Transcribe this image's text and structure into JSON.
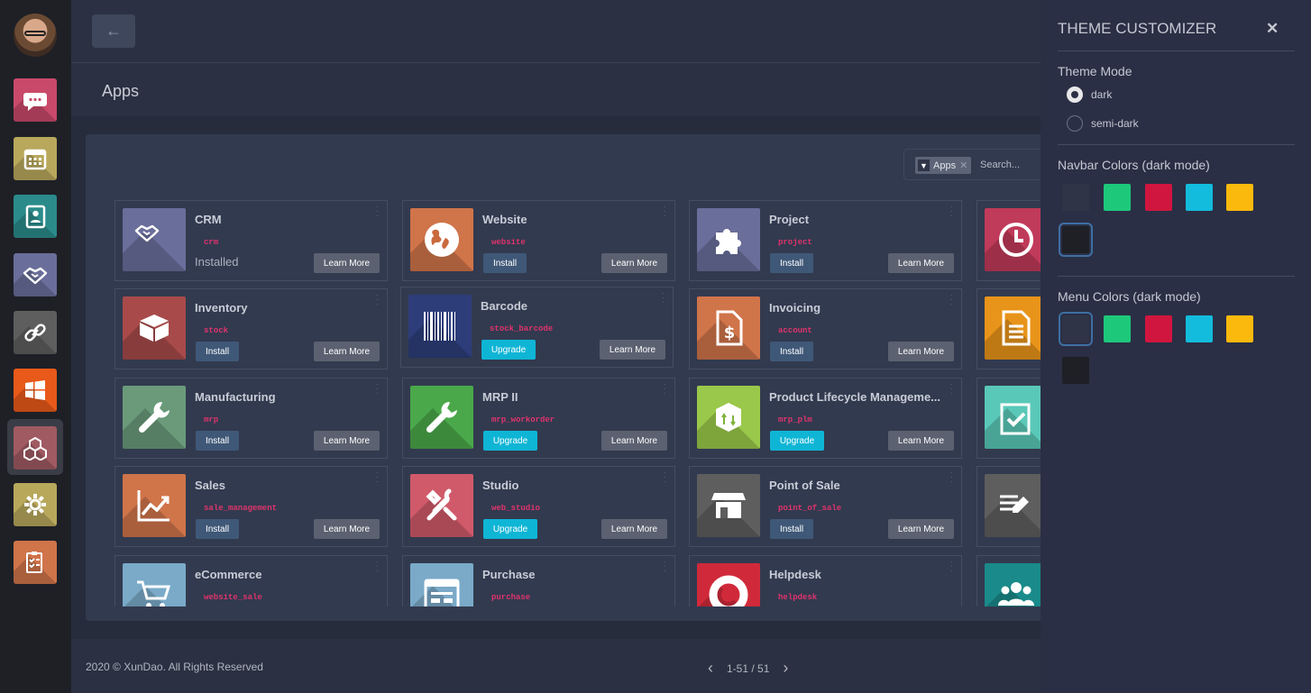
{
  "sidebar": {
    "items": [
      {
        "name": "discuss",
        "icon": "chat-icon",
        "color": "#c9496a"
      },
      {
        "name": "calendar",
        "icon": "calendar-icon",
        "color": "#b8a85c"
      },
      {
        "name": "contacts",
        "icon": "contacts-icon",
        "color": "#2b8b8b"
      },
      {
        "name": "crm",
        "icon": "handshake-icon",
        "color": "#6a6e9a"
      },
      {
        "name": "link",
        "icon": "link-icon",
        "color": "#5e5e5e"
      },
      {
        "name": "windows",
        "icon": "windows-icon",
        "color": "#e8591a"
      },
      {
        "name": "apps",
        "icon": "cubes-icon",
        "color": "#a05a62"
      },
      {
        "name": "settings",
        "icon": "gear-icon",
        "color": "#b8a85c"
      },
      {
        "name": "survey",
        "icon": "survey-icon",
        "color": "#d0744a"
      }
    ]
  },
  "header": {
    "back_icon": "arrow-left-icon",
    "title": "Apps"
  },
  "search": {
    "facet_label": "Apps",
    "placeholder": "Search..."
  },
  "apps": [
    {
      "name": "CRM",
      "tech": "crm",
      "status": "installed",
      "installed_label": "Installed",
      "learn_label": "Learn More",
      "color": "#6a6e9a",
      "icon": "handshake-icon"
    },
    {
      "name": "Website",
      "tech": "website",
      "status": "install",
      "action_label": "Install",
      "learn_label": "Learn More",
      "color": "#d0744a",
      "icon": "globe-icon"
    },
    {
      "name": "Project",
      "tech": "project",
      "status": "install",
      "action_label": "Install",
      "learn_label": "Learn More",
      "color": "#6a6e9a",
      "icon": "puzzle-icon"
    },
    {
      "name": "Inventory",
      "tech": "stock",
      "status": "install",
      "action_label": "Install",
      "learn_label": "Learn More",
      "color": "#a84a4a",
      "icon": "box-icon"
    },
    {
      "name": "Barcode",
      "tech": "stock_barcode",
      "status": "upgrade",
      "action_label": "Upgrade",
      "learn_label": "Learn More",
      "color": "#2d3d7a",
      "icon": "barcode-icon"
    },
    {
      "name": "Invoicing",
      "tech": "account",
      "status": "install",
      "action_label": "Install",
      "learn_label": "Learn More",
      "color": "#d0744a",
      "icon": "invoice-icon"
    },
    {
      "name": "Manufacturing",
      "tech": "mrp",
      "status": "install",
      "action_label": "Install",
      "learn_label": "Learn More",
      "color": "#6a9a7a",
      "icon": "wrench-icon"
    },
    {
      "name": "MRP II",
      "tech": "mrp_workorder",
      "status": "upgrade",
      "action_label": "Upgrade",
      "learn_label": "Learn More",
      "color": "#4aa84a",
      "icon": "wrench-icon"
    },
    {
      "name": "Product Lifecycle Manageme...",
      "tech": "mrp_plm",
      "status": "upgrade",
      "action_label": "Upgrade",
      "learn_label": "Learn More",
      "color": "#9ac84a",
      "icon": "cube-icon"
    },
    {
      "name": "Sales",
      "tech": "sale_management",
      "status": "install",
      "action_label": "Install",
      "learn_label": "Learn More",
      "color": "#d0744a",
      "icon": "chart-icon"
    },
    {
      "name": "Studio",
      "tech": "web_studio",
      "status": "upgrade",
      "action_label": "Upgrade",
      "learn_label": "Learn More",
      "color": "#d05a6a",
      "icon": "tools-icon"
    },
    {
      "name": "Point of Sale",
      "tech": "point_of_sale",
      "status": "install",
      "action_label": "Install",
      "learn_label": "Learn More",
      "color": "#5e5e5e",
      "icon": "store-icon"
    },
    {
      "name": "eCommerce",
      "tech": "website_sale",
      "status": "install",
      "action_label": "Install",
      "learn_label": "Learn More",
      "color": "#7aaac8",
      "icon": "cart-icon"
    },
    {
      "name": "Purchase",
      "tech": "purchase",
      "status": "install",
      "action_label": "Install",
      "learn_label": "Learn More",
      "color": "#7aaac8",
      "icon": "form-icon"
    },
    {
      "name": "Helpdesk",
      "tech": "helpdesk",
      "status": "install",
      "action_label": "Install",
      "learn_label": "Learn More",
      "color": "#d02a3a",
      "icon": "lifebuoy-icon"
    }
  ],
  "partial_apps": [
    {
      "color": "#c03a5a",
      "icon": "clock-icon"
    },
    {
      "color": "#e8941a",
      "icon": "document-icon"
    },
    {
      "color": "#5ac8b8",
      "icon": "clipboard-check-icon"
    },
    {
      "color": "#5e5e5e",
      "icon": "edit-icon"
    },
    {
      "color": "#1a8a8a",
      "icon": "people-icon"
    }
  ],
  "footer": {
    "copyright": "2020 © XunDao. All Rights Reserved",
    "pager": "1-51 / 51",
    "prev_icon": "chevron-left-icon",
    "next_icon": "chevron-right-icon"
  },
  "customizer": {
    "title": "THEME CUSTOMIZER",
    "close_icon": "close-icon",
    "theme_mode_label": "Theme Mode",
    "modes": [
      {
        "label": "dark",
        "checked": true
      },
      {
        "label": "semi-dark",
        "checked": false
      }
    ],
    "navbar_label": "Navbar Colors (dark mode)",
    "navbar_colors": [
      "#2f3547",
      "#1ec87a",
      "#d0163e",
      "#13bcdc",
      "#fcb90d",
      "#1e2026"
    ],
    "navbar_selected": 5,
    "menu_label": "Menu Colors (dark mode)",
    "menu_colors": [
      "#2f3547",
      "#1ec87a",
      "#d0163e",
      "#13bcdc",
      "#fcb90d",
      "#1e2026"
    ],
    "menu_selected": 0
  }
}
